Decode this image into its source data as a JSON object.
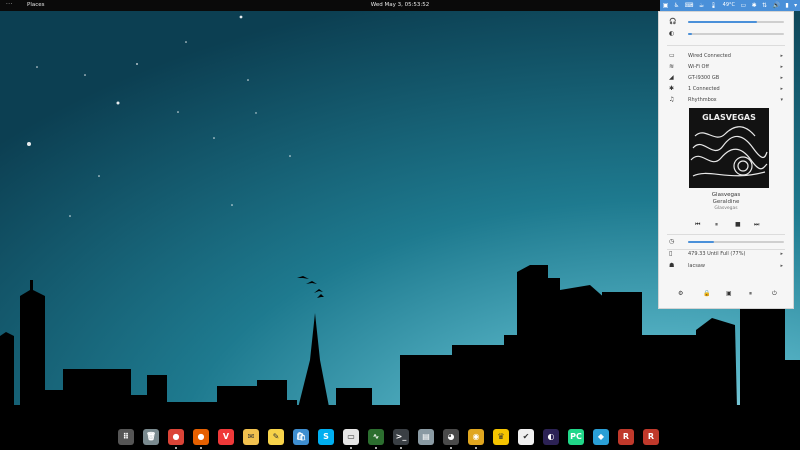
{
  "topbar": {
    "activities": "···",
    "places": "Places",
    "clock": "Wed May  3, 05:53:52",
    "temp": "49°C"
  },
  "menu": {
    "volume": 0.72,
    "brightness": 0.04,
    "network": [
      {
        "label": "Wired Connected",
        "icon": "network-wired-icon"
      },
      {
        "label": "Wi-Fi Off",
        "icon": "wifi-icon"
      },
      {
        "label": "GT-I9300 GB",
        "icon": "signal-icon"
      },
      {
        "label": "1 Connected",
        "icon": "bluetooth-icon"
      }
    ],
    "player": {
      "name": "Rhythmbox",
      "album_art_text": "GLASVEGAS",
      "title": "Glasvegas",
      "artist": "Geraldine",
      "album": "Glasvegas",
      "progress": 0.27
    },
    "battery": "479.33 Until Full (77%)",
    "user": "lacsaw"
  },
  "dock": {
    "apps": [
      {
        "name": "app-grid-icon",
        "color": "#555555"
      },
      {
        "name": "trash-icon",
        "color": "#7a8a8f"
      },
      {
        "name": "chrome-icon",
        "color": "#db4437"
      },
      {
        "name": "firefox-icon",
        "color": "#e66000"
      },
      {
        "name": "vivaldi-icon",
        "color": "#ef3939"
      },
      {
        "name": "mail-icon",
        "color": "#f2c14e"
      },
      {
        "name": "notes-icon",
        "color": "#f7d34a"
      },
      {
        "name": "store-icon",
        "color": "#3e8ed0"
      },
      {
        "name": "skype-icon",
        "color": "#00aff0"
      },
      {
        "name": "monitor-icon",
        "color": "#e6e6e6"
      },
      {
        "name": "system-monitor-icon",
        "color": "#2c6e2f"
      },
      {
        "name": "terminal-icon",
        "color": "#3a3f44"
      },
      {
        "name": "files-icon",
        "color": "#8a9aa3"
      },
      {
        "name": "cat-icon",
        "color": "#4a4a4a"
      },
      {
        "name": "rhythmbox-icon",
        "color": "#e0a61f"
      },
      {
        "name": "tux-icon",
        "color": "#f5c400"
      },
      {
        "name": "document-icon",
        "color": "#f0f0f0"
      },
      {
        "name": "eclipse-icon",
        "color": "#2c2255"
      },
      {
        "name": "pycharm-icon",
        "color": "#21d789"
      },
      {
        "name": "chart-app-icon",
        "color": "#2a9fd6"
      },
      {
        "name": "r-app-icon",
        "color": "#c0392b"
      },
      {
        "name": "r-app-2-icon",
        "color": "#c0392b"
      }
    ],
    "running": [
      2,
      3,
      9,
      10,
      11,
      13,
      14
    ]
  }
}
